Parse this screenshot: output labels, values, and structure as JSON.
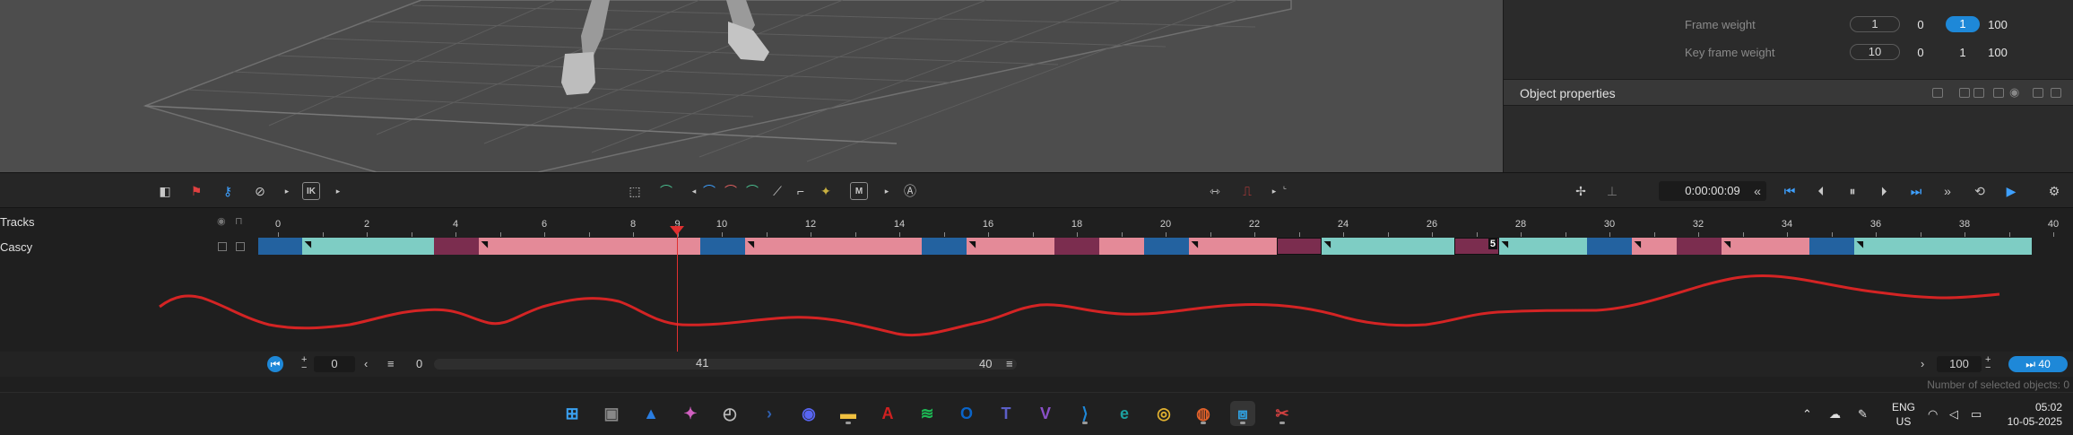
{
  "properties_panel": {
    "rows": [
      {
        "label": "Frame weight",
        "input": "1",
        "min": "0",
        "mid": "1",
        "max": "100",
        "mid_selected": true
      },
      {
        "label": "Key frame weight",
        "input": "10",
        "min": "0",
        "mid": "1",
        "max": "100",
        "mid_selected": false
      }
    ],
    "object_properties_title": "Object properties"
  },
  "toolbar": {
    "ik_label": "IK",
    "m_label": "M",
    "timecode": "0:00:00:09"
  },
  "timeline": {
    "tracks_label": "Tracks",
    "track_name": "Cascy",
    "ruler_ticks": [
      "0",
      "2",
      "4",
      "6",
      "8",
      "9",
      "10",
      "12",
      "14",
      "16",
      "18",
      "20",
      "22",
      "24",
      "26",
      "28",
      "30",
      "32",
      "34",
      "36",
      "38",
      "40"
    ],
    "current_frame": "9",
    "segments": [
      {
        "color": "#2362a0"
      },
      {
        "color": "#7ecdc4",
        "key": true
      },
      {
        "color": "#7b2d4f"
      },
      {
        "color": "#e48a98",
        "key": true
      },
      {
        "color": "#2362a0"
      },
      {
        "color": "#e48a98",
        "key": true
      },
      {
        "color": "#2362a0"
      },
      {
        "color": "#e48a98",
        "key": true
      },
      {
        "color": "#7b2d4f"
      },
      {
        "color": "#e48a98"
      },
      {
        "color": "#2362a0"
      },
      {
        "color": "#e48a98",
        "key": true
      },
      {
        "color": "#7b2d4f",
        "boxed": true
      },
      {
        "color": "#7ecdc4",
        "key": true
      },
      {
        "color": "#7b2d4f",
        "boxed": true,
        "badge": "5"
      },
      {
        "color": "#7ecdc4",
        "key": true
      },
      {
        "color": "#2362a0"
      },
      {
        "color": "#e48a98",
        "key": true
      },
      {
        "color": "#7b2d4f"
      },
      {
        "color": "#e48a98",
        "key": true
      },
      {
        "color": "#2362a0"
      },
      {
        "color": "#7ecdc4",
        "key": true
      }
    ]
  },
  "bottom_bar": {
    "start_value": "0",
    "range_start": "0",
    "scroll_center": "41",
    "range_end": "40",
    "zoom_value": "100",
    "end_frame": "40"
  },
  "status": "Number of selected objects: 0",
  "taskbar": {
    "apps": [
      "start-icon",
      "task-view-icon",
      "photos-icon",
      "copilot-icon",
      "clock-icon",
      "powershell-icon",
      "discord-icon",
      "file-explorer-icon",
      "acrobat-icon",
      "spotify-icon",
      "outlook-icon",
      "teams-icon",
      "visual-studio-icon",
      "vscode-icon",
      "edge-icon",
      "chrome-icon",
      "firefox-icon",
      "animation-app-icon",
      "snipping-tool-icon"
    ],
    "lang_top": "ENG",
    "lang_bottom": "US",
    "time": "05:02",
    "date": "10-05-2025"
  }
}
